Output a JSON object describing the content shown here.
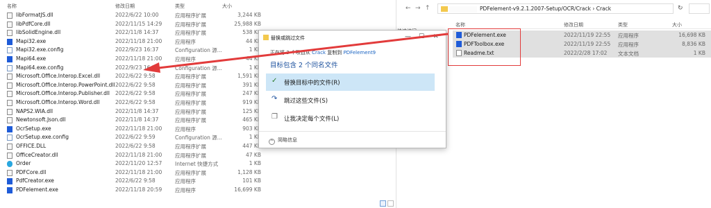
{
  "left_explorer": {
    "headers": {
      "name": "名称",
      "date": "修改日期",
      "type": "类型",
      "size": "大小"
    },
    "files": [
      {
        "name": "libFormatJS.dll",
        "date": "2022/6/22 10:00",
        "type": "应用程序扩展",
        "size": "3,244 KB",
        "icon": "dll"
      },
      {
        "name": "libPdfCore.dll",
        "date": "2022/11/15 14:29",
        "type": "应用程序扩展",
        "size": "25,988 KB",
        "icon": "dll"
      },
      {
        "name": "libSolidEngine.dll",
        "date": "2022/11/8 14:37",
        "type": "应用程序扩展",
        "size": "538 KB",
        "icon": "dll"
      },
      {
        "name": "Mapi32.exe",
        "date": "2022/11/18 21:00",
        "type": "应用程序",
        "size": "44 KB",
        "icon": "exe"
      },
      {
        "name": "Mapi32.exe.config",
        "date": "2022/9/23 16:37",
        "type": "Configuration 源...",
        "size": "1 KB",
        "icon": "cfg"
      },
      {
        "name": "Mapi64.exe",
        "date": "2022/11/18 21:00",
        "type": "应用程序",
        "size": "44 KB",
        "icon": "exe"
      },
      {
        "name": "Mapi64.exe.config",
        "date": "2022/9/23 16:37",
        "type": "Configuration 源...",
        "size": "1 KB",
        "icon": "cfg"
      },
      {
        "name": "Microsoft.Office.Interop.Excel.dll",
        "date": "2022/6/22 9:58",
        "type": "应用程序扩展",
        "size": "1,591 KB",
        "icon": "dll"
      },
      {
        "name": "Microsoft.Office.Interop.PowerPoint.dll",
        "date": "2022/6/22 9:58",
        "type": "应用程序扩展",
        "size": "391 KB",
        "icon": "dll"
      },
      {
        "name": "Microsoft.Office.Interop.Publisher.dll",
        "date": "2022/6/22 9:58",
        "type": "应用程序扩展",
        "size": "247 KB",
        "icon": "dll"
      },
      {
        "name": "Microsoft.Office.Interop.Word.dll",
        "date": "2022/6/22 9:58",
        "type": "应用程序扩展",
        "size": "919 KB",
        "icon": "dll"
      },
      {
        "name": "NAPS2.WIA.dll",
        "date": "2022/11/8 14:37",
        "type": "应用程序扩展",
        "size": "125 KB",
        "icon": "dll"
      },
      {
        "name": "Newtonsoft.Json.dll",
        "date": "2022/11/8 14:37",
        "type": "应用程序扩展",
        "size": "465 KB",
        "icon": "dll"
      },
      {
        "name": "OcrSetup.exe",
        "date": "2022/11/18 21:00",
        "type": "应用程序",
        "size": "903 KB",
        "icon": "exe"
      },
      {
        "name": "OcrSetup.exe.config",
        "date": "2022/6/22 9:59",
        "type": "Configuration 源...",
        "size": "1 KB",
        "icon": "cfg"
      },
      {
        "name": "OFFICE.DLL",
        "date": "2022/6/22 9:58",
        "type": "应用程序扩展",
        "size": "447 KB",
        "icon": "dll"
      },
      {
        "name": "OfficeCreator.dll",
        "date": "2022/11/18 21:00",
        "type": "应用程序扩展",
        "size": "47 KB",
        "icon": "dll"
      },
      {
        "name": "Order",
        "date": "2022/11/20 12:57",
        "type": "Internet 快捷方式",
        "size": "1 KB",
        "icon": "lnk"
      },
      {
        "name": "PDFCore.dll",
        "date": "2022/11/18 21:00",
        "type": "应用程序扩展",
        "size": "1,128 KB",
        "icon": "dll"
      },
      {
        "name": "PdfCreator.exe",
        "date": "2022/6/22 9:58",
        "type": "应用程序",
        "size": "101 KB",
        "icon": "exe"
      },
      {
        "name": "PDFelement.exe",
        "date": "2022/11/18 20:59",
        "type": "应用程序",
        "size": "16,699 KB",
        "icon": "exe"
      }
    ]
  },
  "right_explorer": {
    "path": "PDFelement-v9.2.1.2007-Setup/OCR/Crack  ›  Crack",
    "sidebar_label": "快速访问",
    "headers": {
      "name": "名称",
      "date": "修改日期",
      "type": "类型",
      "size": "大小"
    },
    "files": [
      {
        "name": "PDFelement.exe",
        "date": "2022/11/19 22:55",
        "type": "应用程序",
        "size": "16,698 KB",
        "icon": "exe"
      },
      {
        "name": "PDFToolbox.exe",
        "date": "2022/11/19 22:55",
        "type": "应用程序",
        "size": "8,836 KB",
        "icon": "exe"
      },
      {
        "name": "Readme.txt",
        "date": "2022/2/28 17:02",
        "type": "文本文档",
        "size": "1 KB",
        "icon": "txt"
      }
    ]
  },
  "dialog": {
    "title": "替换或跳过文件",
    "copy_prefix": "正在将 3 个项目从 ",
    "copy_source": "Crack",
    "copy_mid": " 复制到 ",
    "copy_dest": "PDFelement9",
    "heading": "目标包含 2 个同名文件",
    "options": [
      {
        "label": "替换目标中的文件(R)",
        "glyph": "✓",
        "selected": true
      },
      {
        "label": "跳过这些文件(S)",
        "glyph": "↷",
        "selected": false
      },
      {
        "label": "让我决定每个文件(L)",
        "glyph": "❐",
        "selected": false
      }
    ],
    "more_label": "简略信息",
    "minimize_glyph": "—",
    "maximize_glyph": "☐",
    "close_glyph": "✕"
  },
  "colors": {
    "accent": "#1a63c2",
    "selected": "#cde6f7",
    "annotation_red": "#e23b3b"
  }
}
